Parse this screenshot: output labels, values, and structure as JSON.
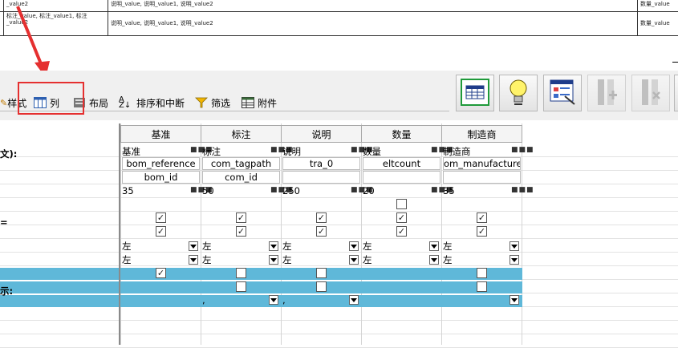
{
  "preview_rows": [
    {
      "col1": "_value2",
      "col2": "说明_value, 说明_value1, 说明_value2",
      "col3": "数量_value"
    },
    {
      "col1": "标注_value, 标注_value1, 标注_value2",
      "col2": "说明_value, 说明_value1, 说明_value2",
      "col3": "数量_value"
    }
  ],
  "toolbar": {
    "tabs": [
      {
        "label": "样式",
        "icon": "style-icon"
      },
      {
        "label": "列",
        "icon": "columns-icon"
      },
      {
        "label": "布局",
        "icon": "layout-icon"
      },
      {
        "label": "排序和中断",
        "icon": "sort-icon"
      },
      {
        "label": "筛选",
        "icon": "filter-icon"
      },
      {
        "label": "附件",
        "icon": "attachment-icon"
      }
    ],
    "buttons": [
      {
        "name": "table-grid-icon"
      },
      {
        "name": "lightbulb-icon"
      },
      {
        "name": "properties-icon"
      },
      {
        "name": "insert-column-icon"
      },
      {
        "name": "delete-column-icon"
      }
    ]
  },
  "grid": {
    "row_labels": [
      "文):",
      "=",
      "示:"
    ],
    "columns": [
      {
        "header": "基准",
        "title": "基准",
        "field": "bom_reference",
        "field2": "bom_id",
        "width": "35",
        "align1": "左",
        "align2": "左"
      },
      {
        "header": "标注",
        "title": "标注",
        "field": "com_tagpath",
        "field2": "com_id",
        "width": "50",
        "align1": "左",
        "align2": "左"
      },
      {
        "header": "说明",
        "title": "说明",
        "field": "tra_0",
        "field2": "",
        "width": "250",
        "align1": "左",
        "align2": "左"
      },
      {
        "header": "数量",
        "title": "数量",
        "field": "eltcount",
        "field2": "",
        "width": "20",
        "align1": "左",
        "align2": "左"
      },
      {
        "header": "制造商",
        "title": "制造商",
        "field": "bom_manufacturer",
        "field2": "",
        "width": "35",
        "align1": "左",
        "align2": "左"
      }
    ],
    "separator_values": [
      "",
      ",",
      ",",
      "",
      ""
    ],
    "dots": "■■■"
  },
  "colors": {
    "highlight": "#e53030",
    "row_blue": "#5fb8d9"
  }
}
